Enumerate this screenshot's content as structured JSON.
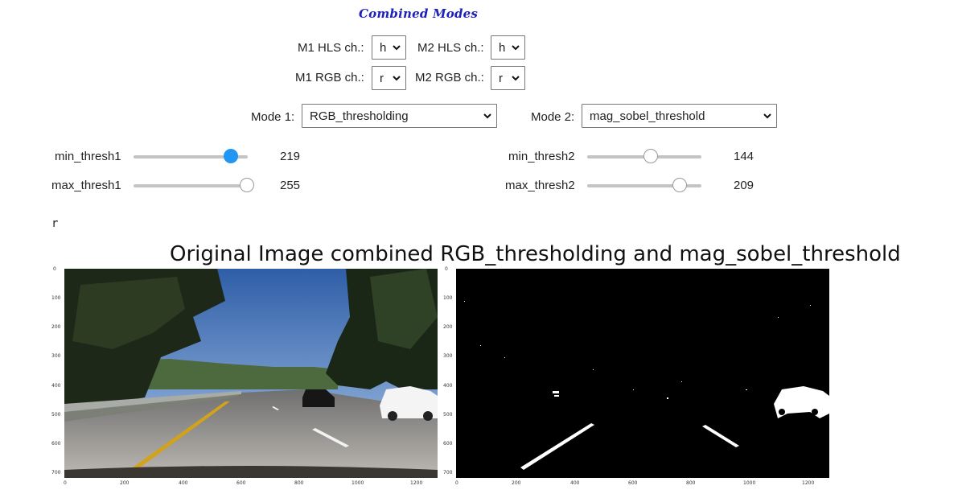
{
  "title": "Combined Modes",
  "controls": {
    "m1_hls": {
      "label": "M1 HLS ch.:",
      "value": "h"
    },
    "m2_hls": {
      "label": "M2 HLS ch.:",
      "value": "h"
    },
    "m1_rgb": {
      "label": "M1 RGB ch.:",
      "value": "r"
    },
    "m2_rgb": {
      "label": "M2 RGB ch.:",
      "value": "r"
    },
    "mode1": {
      "label": "Mode 1:",
      "value": "RGB_thresholding"
    },
    "mode2": {
      "label": "Mode 2:",
      "value": "mag_sobel_threshold"
    }
  },
  "sliders": {
    "min_thresh1": {
      "label": "min_thresh1",
      "value": "219",
      "level": 0.86
    },
    "max_thresh1": {
      "label": "max_thresh1",
      "value": "255",
      "level": 1.0
    },
    "min_thresh2": {
      "label": "min_thresh2",
      "value": "144",
      "level": 0.565
    },
    "max_thresh2": {
      "label": "max_thresh2",
      "value": "209",
      "level": 0.82
    }
  },
  "output_text": "r",
  "figure": {
    "title": "Original Image combined RGB_thresholding and mag_sobel_threshold",
    "y_ticks": [
      "0",
      "100",
      "200",
      "300",
      "400",
      "500",
      "600",
      "700"
    ],
    "x_ticks": [
      "0",
      "200",
      "400",
      "600",
      "800",
      "1000",
      "1200"
    ]
  }
}
